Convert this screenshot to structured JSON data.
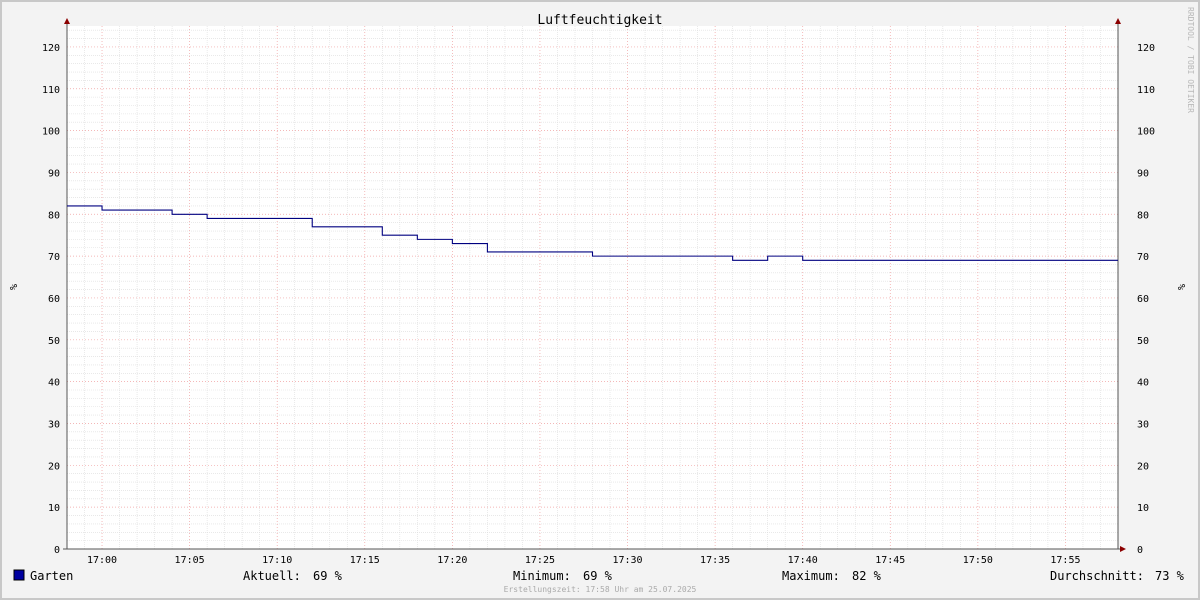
{
  "chart_data": {
    "type": "line",
    "title": "Luftfeuchtigkeit",
    "ylabel": "%",
    "watermark": "RRDTOOL / TOBI OETIKER",
    "ylim": [
      0,
      125
    ],
    "y_ticks": [
      0,
      10,
      20,
      30,
      40,
      50,
      60,
      70,
      80,
      90,
      100,
      110,
      120
    ],
    "x_range_minutes": [
      "16:58",
      "17:58"
    ],
    "x_tick_labels": [
      "17:00",
      "17:05",
      "17:10",
      "17:15",
      "17:20",
      "17:25",
      "17:30",
      "17:35",
      "17:40",
      "17:45",
      "17:50",
      "17:55"
    ],
    "grid": true,
    "series": [
      {
        "name": "Garten",
        "color": "#000080",
        "points": [
          {
            "t": "16:58",
            "v": 82
          },
          {
            "t": "17:00",
            "v": 81
          },
          {
            "t": "17:04",
            "v": 80
          },
          {
            "t": "17:06",
            "v": 79
          },
          {
            "t": "17:12",
            "v": 77
          },
          {
            "t": "17:16",
            "v": 75
          },
          {
            "t": "17:18",
            "v": 74
          },
          {
            "t": "17:20",
            "v": 73
          },
          {
            "t": "17:22",
            "v": 71
          },
          {
            "t": "17:28",
            "v": 70
          },
          {
            "t": "17:36",
            "v": 69
          },
          {
            "t": "17:38",
            "v": 70
          },
          {
            "t": "17:40",
            "v": 69
          },
          {
            "t": "17:58",
            "v": 69
          }
        ]
      }
    ]
  },
  "legend": {
    "series_name": "Garten",
    "series_color": "#0000a0",
    "current_label": "Aktuell:",
    "current_value": "69 %",
    "min_label": "Minimum:",
    "min_value": "69 %",
    "max_label": "Maximum:",
    "max_value": "82 %",
    "avg_label": "Durchschnitt:",
    "avg_value": "73 %"
  },
  "footer": "Erstellungszeit: 17:58 Uhr am 25.07.2025"
}
